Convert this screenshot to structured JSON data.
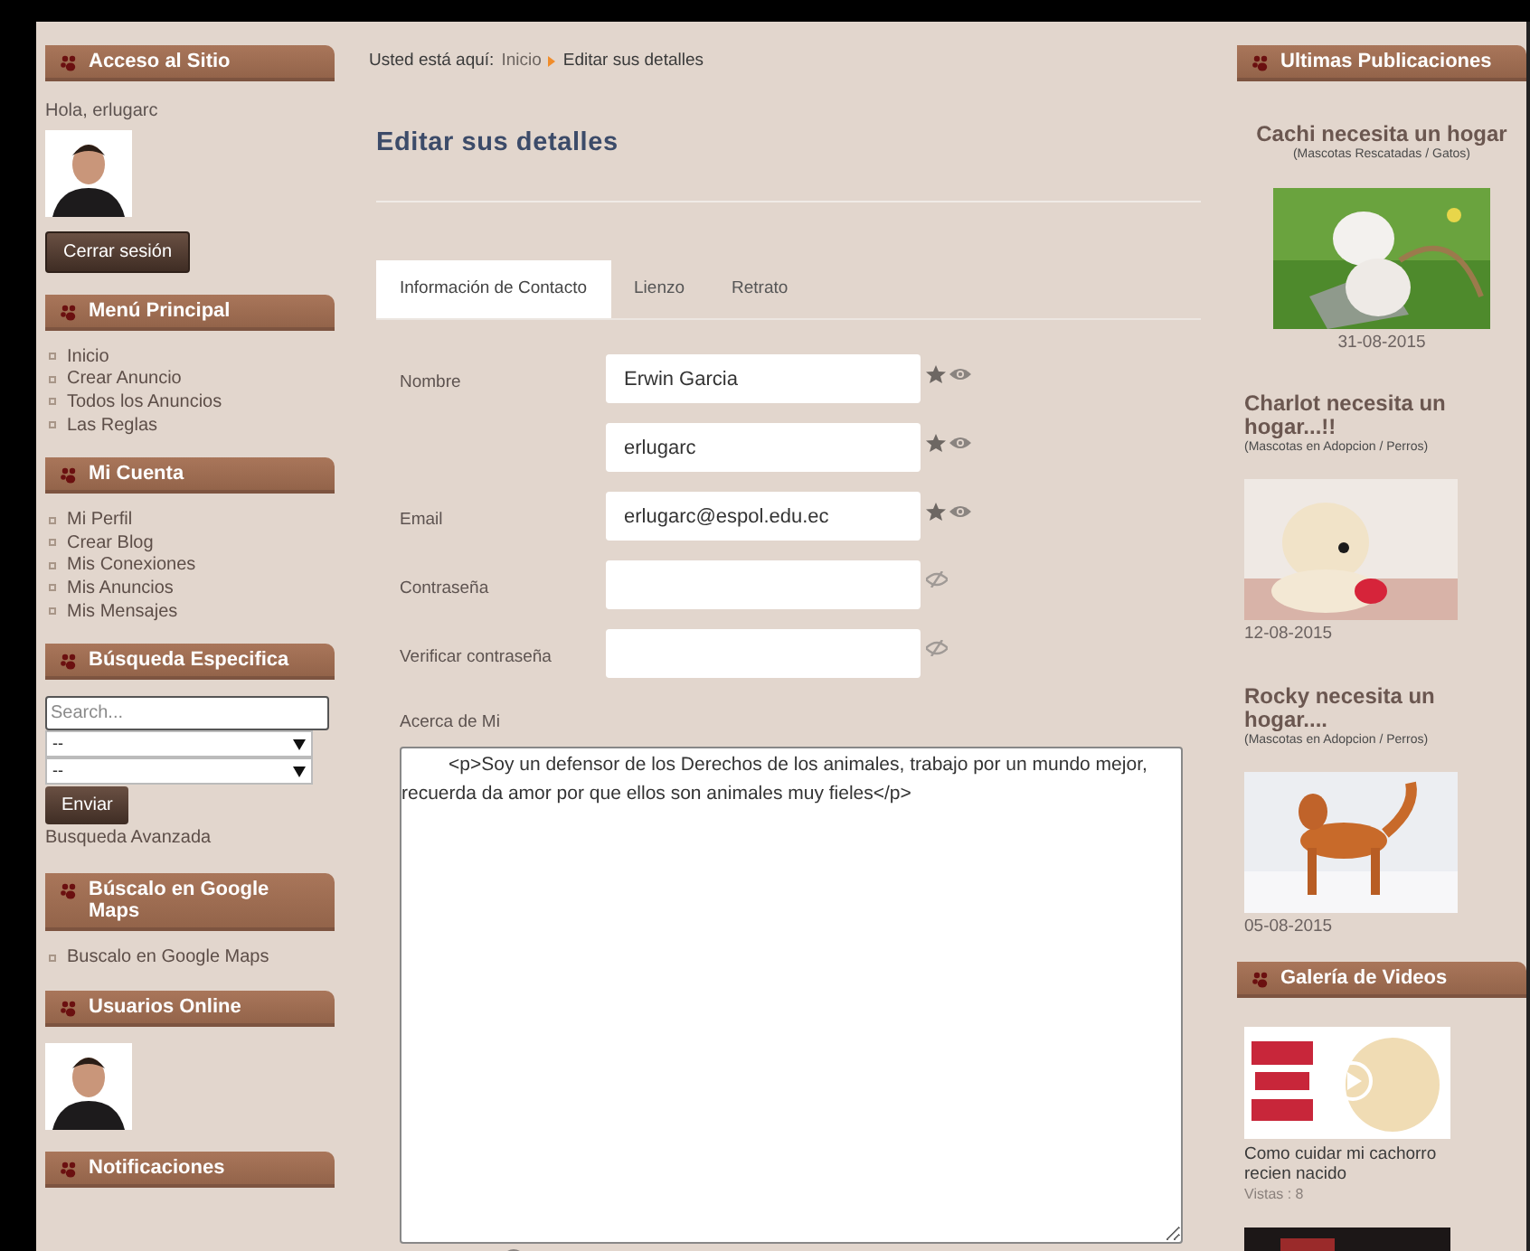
{
  "left_sidebar": [
    {
      "kind": "login",
      "title": "Acceso al Sitio",
      "greeting": "Hola, erlugarc",
      "button": "Cerrar sesión"
    },
    {
      "kind": "menu",
      "title": "Menú Principal",
      "items": [
        "Inicio",
        "Crear Anuncio",
        "Todos los Anuncios",
        "Las Reglas"
      ]
    },
    {
      "kind": "menu",
      "title": "Mi Cuenta",
      "items": [
        "Mi Perfil",
        "Crear Blog",
        "Mis Conexiones",
        "Mis Anuncios",
        "Mis Mensajes"
      ]
    },
    {
      "kind": "search",
      "title": "Búsqueda Especifica",
      "placeholder": "Search...",
      "selects": [
        "--",
        "--"
      ],
      "button": "Enviar",
      "link": "Busqueda Avanzada"
    },
    {
      "kind": "menu",
      "title": "Búscalo en Google Maps",
      "items": [
        "Buscalo en Google Maps"
      ]
    },
    {
      "kind": "users",
      "title": "Usuarios Online"
    },
    {
      "kind": "empty",
      "title": "Notificaciones"
    }
  ],
  "breadcrumb": {
    "label": "Usted está aquí:",
    "items": [
      "Inicio",
      "Editar sus detalles"
    ]
  },
  "page_title": "Editar sus detalles",
  "tabs": [
    {
      "label": "Información de Contacto",
      "selected": true
    },
    {
      "label": "Lienzo",
      "selected": false
    },
    {
      "label": "Retrato",
      "selected": false
    }
  ],
  "fields": [
    {
      "label": "Nombre",
      "value": "Erwin Garcia",
      "starred": true,
      "eye_slashed": false
    },
    {
      "value": "erlugarc",
      "starred": true,
      "eye_slashed": false
    },
    {
      "label": "Email",
      "value": "erlugarc@espol.edu.ec",
      "starred": true,
      "eye_slashed": false
    },
    {
      "label": "Contraseña",
      "starred": false,
      "eye_slashed": true
    },
    {
      "label": "Verificar contraseña",
      "starred": false,
      "eye_slashed": true
    }
  ],
  "about": {
    "label": "Acerca de Mi",
    "value": "<p>Soy un defensor de los Derechos de los animales, trabajo por un mundo mejor, recuerda da amor por que ellos son animales muy fieles</p>"
  },
  "right_sidebar": {
    "title": "Ultimas Publicaciones",
    "posts": [
      {
        "title": "Cachi necesita un hogar",
        "category": "(Mascotas Rescatadas / Gatos)",
        "date": "31-08-2015",
        "centered": true
      },
      {
        "title": "Charlot necesita un hogar...!!",
        "category": "(Mascotas en Adopcion / Perros)",
        "date": "12-08-2015",
        "centered": false
      },
      {
        "title": "Rocky necesita un hogar....",
        "category": "(Mascotas en Adopcion / Perros)",
        "date": "05-08-2015",
        "centered": false
      }
    ],
    "videos_title": "Galería de Videos",
    "videos": [
      {
        "title": "Como cuidar mi cachorro recien nacido",
        "views": "Vistas : 8"
      }
    ]
  }
}
